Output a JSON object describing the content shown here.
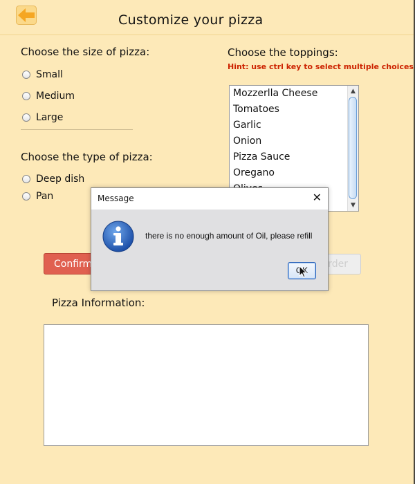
{
  "window": {
    "title": "Customize your pizza"
  },
  "size_section": {
    "label": "Choose the size of pizza:",
    "options": [
      "Small",
      "Medium",
      "Large"
    ]
  },
  "type_section": {
    "label": "Choose the type of pizza:",
    "options": [
      "Deep dish",
      "Pan"
    ]
  },
  "toppings_section": {
    "label": "Choose the toppings:",
    "hint": "Hint: use ctrl key to select multiple choices",
    "items": [
      "Mozzerlla Cheese",
      "Tomatoes",
      "Garlic",
      "Onion",
      "Pizza Sauce",
      "Oregano",
      "Olives"
    ]
  },
  "buttons": {
    "confirm": "Confirm",
    "order": "Order"
  },
  "info_section": {
    "label": "Pizza Information:"
  },
  "dialog": {
    "title": "Message",
    "close": "✕",
    "message": "there is no enough amount of Oil, please refill",
    "ok": "OK",
    "icon": "info-icon"
  },
  "colors": {
    "background": "#fde9b8",
    "confirm_button": "#e06050",
    "hint_text": "#cc2200",
    "back_arrow": "#f5a623"
  },
  "icons": {
    "back": "back-arrow-icon",
    "scroll_up": "chevron-up-icon",
    "scroll_down": "chevron-down-icon",
    "cursor": "mouse-cursor-icon"
  }
}
